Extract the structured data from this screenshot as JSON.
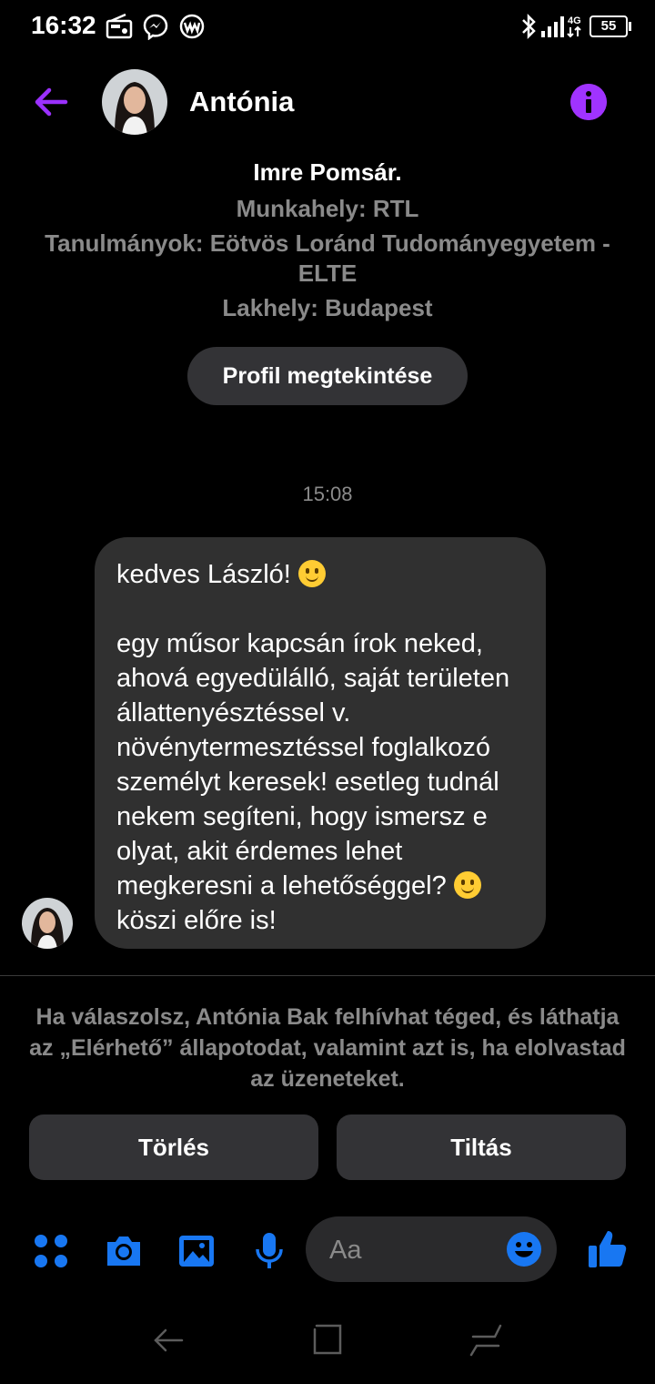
{
  "status_bar": {
    "time": "16:32",
    "network": "4G",
    "battery": "55",
    "icons": [
      "radio-icon",
      "messenger-icon",
      "app-icon",
      "bluetooth-icon",
      "signal-icon"
    ]
  },
  "header": {
    "contact_name": "Antónia"
  },
  "profile": {
    "mutual_end": "Imre Pomsár.",
    "work": "Munkahely: RTL",
    "studies_line1": "Tanulmányok: Eötvös Loránd Tudományegyetem -",
    "studies_line2": "ELTE",
    "residence": "Lakhely: Budapest",
    "view_profile_label": "Profil megtekintése"
  },
  "conversation": {
    "timestamp": "15:08",
    "message": {
      "line1": "kedves László! ",
      "body": "egy műsor kapcsán írok neked, ahová egyedülálló, saját területen állattenyésztéssel v. növénytermesztéssel foglalkozó személyt keresek! esetleg tudnál nekem segíteni, hogy ismersz e olyat, akit érdemes lehet megkeresni a lehetőséggel? ",
      "tail": " köszi előre is!"
    }
  },
  "request": {
    "notice": "Ha válaszolsz, Antónia Bak felhívhat téged, és láthatja az „Elérhető” állapotodat, valamint azt is, ha elolvastad az üzeneteket.",
    "delete_label": "Törlés",
    "block_label": "Tiltás"
  },
  "composer": {
    "placeholder": "Aa"
  },
  "colors": {
    "accent": "#1877f2",
    "info": "#a033ff",
    "back_arrow": "#9b30ff",
    "bubble": "#303030"
  }
}
